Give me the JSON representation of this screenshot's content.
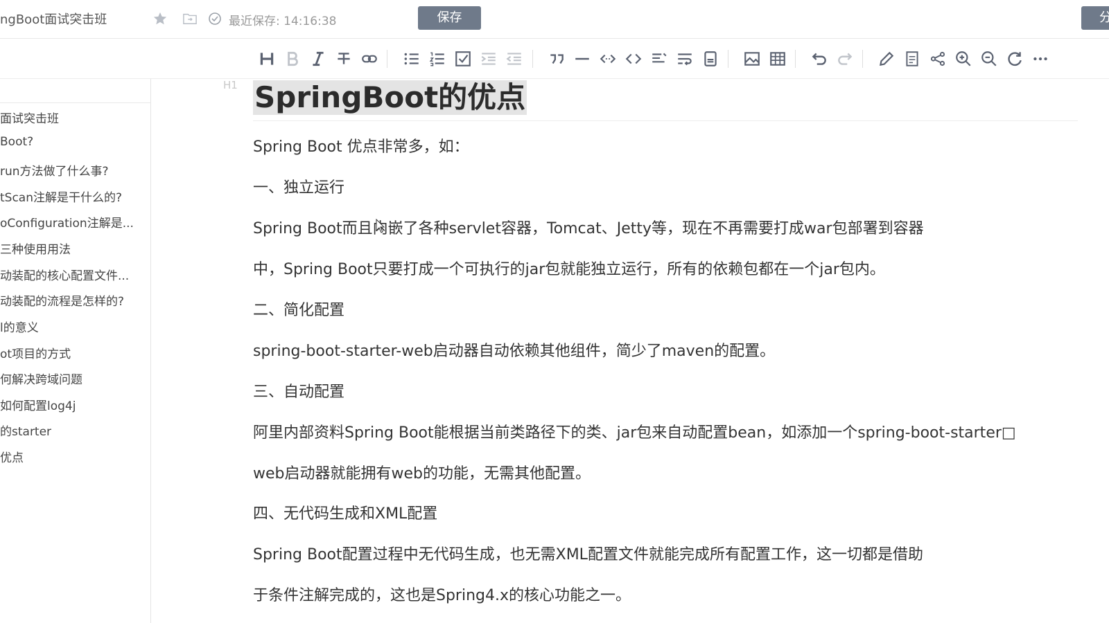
{
  "header": {
    "doc_title": "ngBoot面试突击班",
    "save_status": "最近保存: 14:16:38",
    "save_label": "保存",
    "share_label": "分享"
  },
  "toolbar": {
    "buttons": [
      "heading-icon",
      "bold-icon",
      "italic-icon",
      "strikethrough-icon",
      "link-icon",
      "bullet-list-icon",
      "numbered-list-icon",
      "checkbox-list-icon",
      "indent-icon",
      "outdent-icon",
      "quote-icon",
      "horizontal-rule-icon",
      "inline-code-icon",
      "code-block-icon",
      "align-icon",
      "wrap-icon",
      "attachment-icon",
      "image-icon",
      "table-icon",
      "undo-icon",
      "redo-icon",
      "pen-icon",
      "ppt-icon",
      "mindmap-icon",
      "zoom-in-icon",
      "zoom-out-icon",
      "refresh-icon",
      "more-icon"
    ]
  },
  "sidebar": {
    "items": [
      {
        "label": "面试突击班"
      },
      {
        "label": "Boot?"
      },
      {
        "label": "run方法做了什么事?"
      },
      {
        "label": "tScan注解是干什么的?"
      },
      {
        "label": "oConfiguration注解是..."
      },
      {
        "label": "三种使用用法"
      },
      {
        "label": "动装配的核心配置文件..."
      },
      {
        "label": "动装配的流程是怎样的?"
      },
      {
        "label": "l的意义"
      },
      {
        "label": "ot项目的方式"
      },
      {
        "label": "何解决跨域问题"
      },
      {
        "label": "如何配置log4j"
      },
      {
        "label": "的starter"
      },
      {
        "label": "优点"
      }
    ]
  },
  "document": {
    "heading_marker": "H1",
    "heading": "SpringBoot的优点",
    "paragraphs": [
      "Spring Boot 优点非常多，如：",
      "一、独立运行",
      "Spring Boot而且内嵌了各种servlet容器，Tomcat、Jetty等，现在不再需要打成war包部署到容器",
      "中，Spring Boot只要打成一个可执行的jar包就能独立运行，所有的依赖包都在一个jar包内。",
      "二、简化配置",
      "spring-boot-starter-web启动器自动依赖其他组件，简少了maven的配置。",
      "三、自动配置",
      "阿里内部资料Spring Boot能根据当前类路径下的类、jar包来自动配置bean，如添加一个spring-boot-starter□",
      "web启动器就能拥有web的功能，无需其他配置。",
      "四、无代码生成和XML配置",
      "Spring Boot配置过程中无代码生成，也无需XML配置文件就能完成所有配置工作，这一切都是借助",
      "于条件注解完成的，这也是Spring4.x的核心功能之一。"
    ]
  }
}
